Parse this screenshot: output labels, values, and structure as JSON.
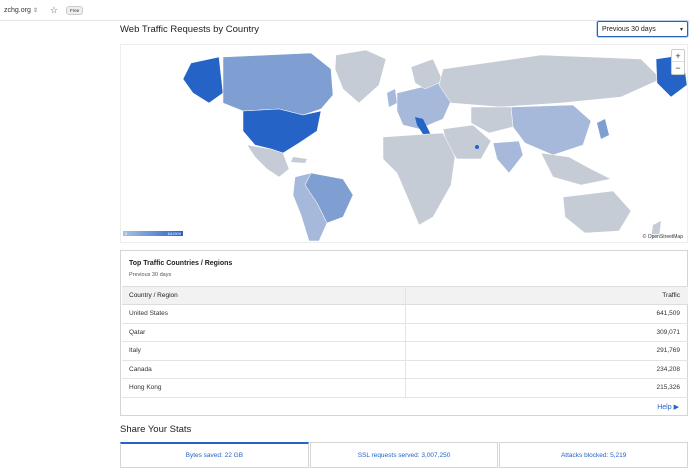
{
  "browser": {
    "site": "zchg.org",
    "pill": "Free"
  },
  "page": {
    "title": "Web Traffic Requests by Country",
    "period": "Previous 30 days"
  },
  "map": {
    "credit": "© OpenStreetMap",
    "legend_min": "0",
    "legend_max": "641509",
    "colors": {
      "max": "#2563c7",
      "high": "#4f7fcc",
      "mid": "#7f9fd2",
      "low": "#a6b9da",
      "none": "#c6ccd6"
    }
  },
  "top_countries": {
    "title": "Top Traffic Countries / Regions",
    "subtitle": "Previous 30 days",
    "col_country": "Country / Region",
    "col_traffic": "Traffic",
    "rows": [
      {
        "country": "United States",
        "traffic": "641,509"
      },
      {
        "country": "Qatar",
        "traffic": "309,071"
      },
      {
        "country": "Italy",
        "traffic": "291,769"
      },
      {
        "country": "Canada",
        "traffic": "234,208"
      },
      {
        "country": "Hong Kong",
        "traffic": "215,326"
      }
    ],
    "help": "Help"
  },
  "share": {
    "title": "Share Your Stats",
    "stats": [
      {
        "label": "Bytes saved: 22 GB"
      },
      {
        "label": "SSL requests served: 3,007,250"
      },
      {
        "label": "Attacks blocked: 5,219"
      }
    ]
  }
}
